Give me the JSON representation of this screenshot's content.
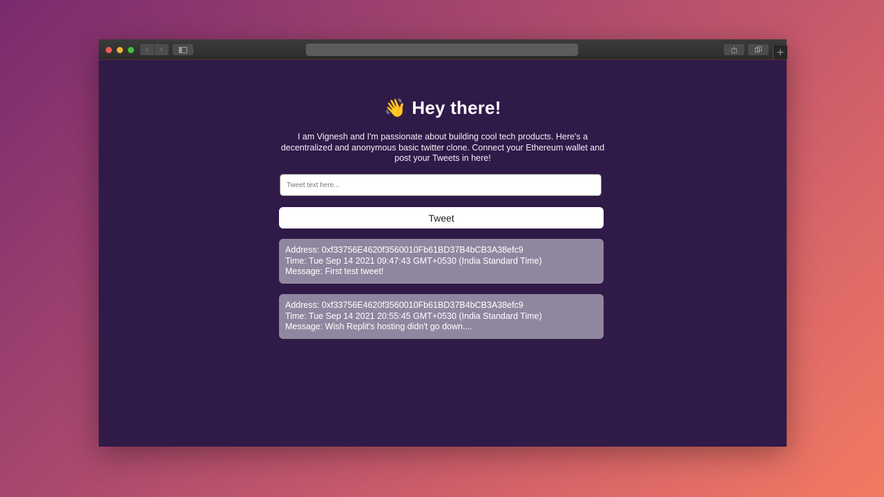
{
  "browser": {
    "nav_back_icon": "chevron-left-icon",
    "nav_forward_icon": "chevron-right-icon",
    "new_tab_label": "+"
  },
  "page": {
    "heading_emoji": "👋",
    "heading_text": "Hey there!",
    "intro": "I am Vignesh and I'm passionate about building cool tech products. Here's a decentralized and anonymous basic twitter clone. Connect your Ethereum wallet and post your Tweets in here!",
    "input_placeholder": "Tweet text here...",
    "tweet_button_label": "Tweet",
    "tweets": [
      {
        "address": "Address: 0xf33756E4620f3560010Fb61BD37B4bCB3A38efc9",
        "time": "Time: Tue Sep 14 2021 09:47:43 GMT+0530 (India Standard Time)",
        "message": "Message: First test tweet!"
      },
      {
        "address": "Address: 0xf33756E4620f3560010Fb61BD37B4bCB3A38efc9",
        "time": "Time: Tue Sep 14 2021 20:55:45 GMT+0530 (India Standard Time)",
        "message": "Message: Wish Replit's hosting didn't go down...."
      }
    ]
  },
  "colors": {
    "page_background": "#301a48",
    "card_background": "#8f879f"
  }
}
